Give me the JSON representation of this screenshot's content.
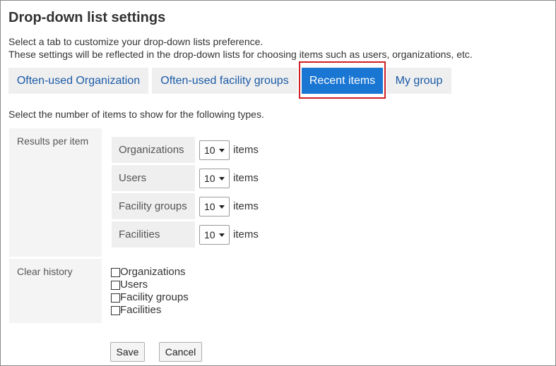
{
  "page": {
    "title": "Drop-down list settings",
    "description_line1": "Select a tab to customize your drop-down lists preference.",
    "description_line2": "These settings will be reflected in the drop-down lists for choosing items such as users, organizations, etc."
  },
  "tabs": [
    {
      "label": "Often-used Organization",
      "active": false
    },
    {
      "label": "Often-used facility groups",
      "active": false
    },
    {
      "label": "Recent items",
      "active": true
    },
    {
      "label": "My group",
      "active": false
    }
  ],
  "instruction": "Select the number of items to show for the following types.",
  "results_per_item": {
    "label": "Results per item",
    "unit": "items",
    "rows": [
      {
        "label": "Organizations",
        "value": "10"
      },
      {
        "label": "Users",
        "value": "10"
      },
      {
        "label": "Facility groups",
        "value": "10"
      },
      {
        "label": "Facilities",
        "value": "10"
      }
    ]
  },
  "clear_history": {
    "label": "Clear history",
    "options": [
      {
        "label": "Organizations",
        "checked": false
      },
      {
        "label": "Users",
        "checked": false
      },
      {
        "label": "Facility groups",
        "checked": false
      },
      {
        "label": "Facilities",
        "checked": false
      }
    ]
  },
  "buttons": {
    "save": "Save",
    "cancel": "Cancel"
  },
  "colors": {
    "active_tab": "#1976d2",
    "tab_text": "#1a5aa6",
    "highlight": "#d11f24"
  }
}
